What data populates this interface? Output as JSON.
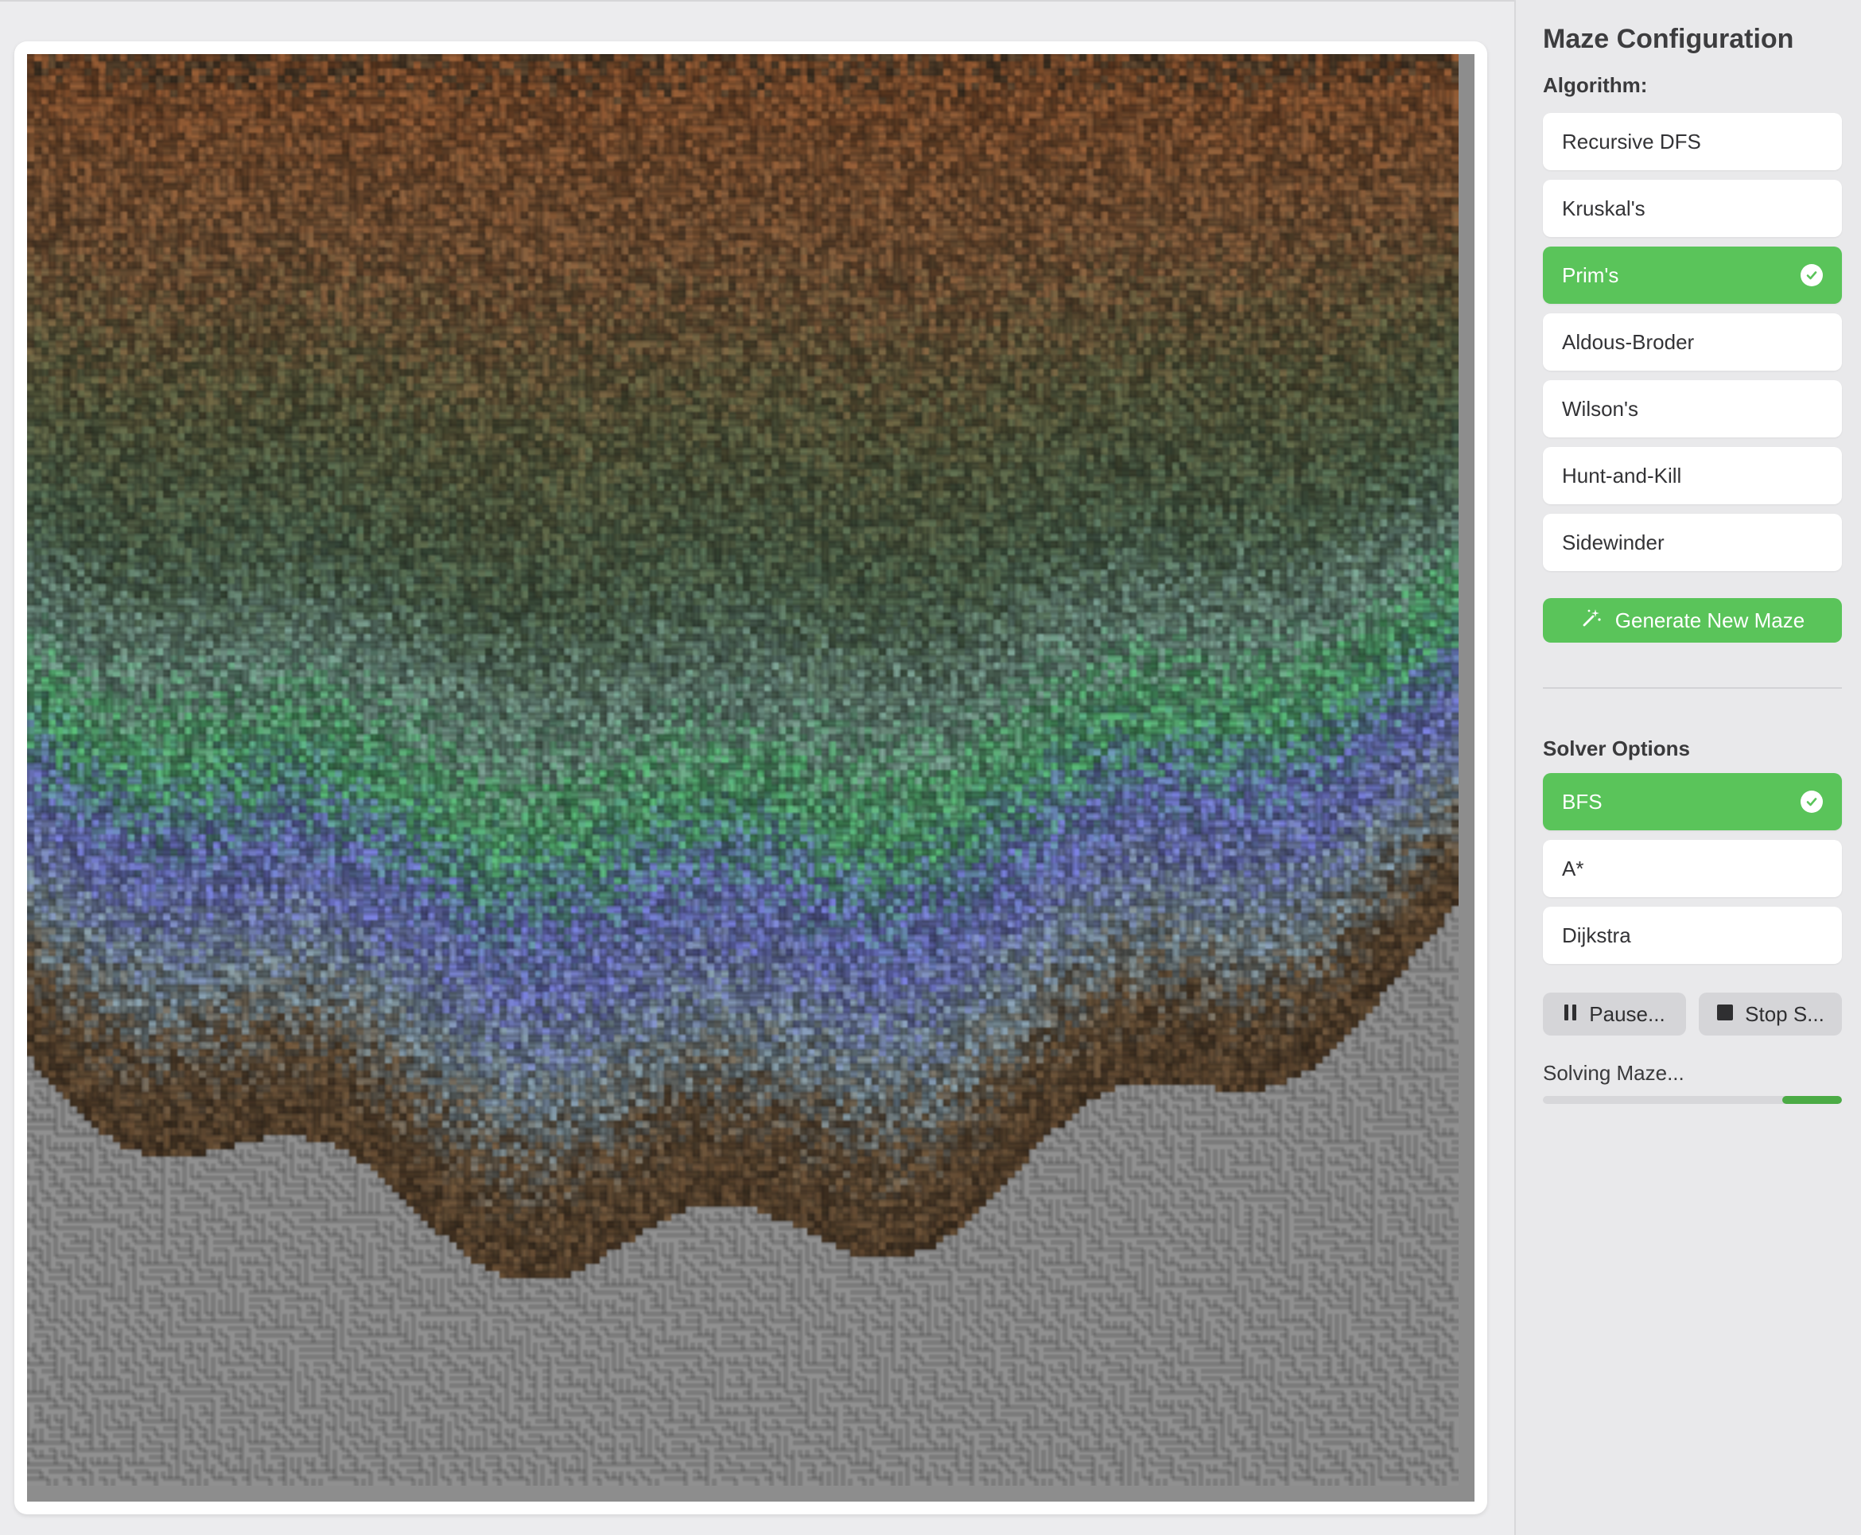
{
  "sidebar": {
    "title": "Maze Configuration",
    "algorithm_label": "Algorithm:",
    "algorithms": [
      {
        "label": "Recursive DFS",
        "selected": false
      },
      {
        "label": "Kruskal's",
        "selected": false
      },
      {
        "label": "Prim's",
        "selected": true
      },
      {
        "label": "Aldous-Broder",
        "selected": false
      },
      {
        "label": "Wilson's",
        "selected": false
      },
      {
        "label": "Hunt-and-Kill",
        "selected": false
      },
      {
        "label": "Sidewinder",
        "selected": false
      }
    ],
    "generate_label": "Generate New Maze",
    "solver_label": "Solver Options",
    "solvers": [
      {
        "label": "BFS",
        "selected": true
      },
      {
        "label": "A*",
        "selected": false
      },
      {
        "label": "Dijkstra",
        "selected": false
      }
    ],
    "pause_label": "Pause...",
    "stop_label": "Stop S...",
    "status_text": "Solving Maze...",
    "progress": 0.2
  },
  "colors": {
    "accent": "#5ac45a",
    "progress": "#4bab45",
    "sidebar_bg": "#e9e9eb",
    "unvisited": "#909090"
  },
  "icons": {
    "selected": "checkmark-circle-icon",
    "generate": "magic-wand-icon",
    "pause": "pause-icon",
    "stop": "stop-icon"
  }
}
